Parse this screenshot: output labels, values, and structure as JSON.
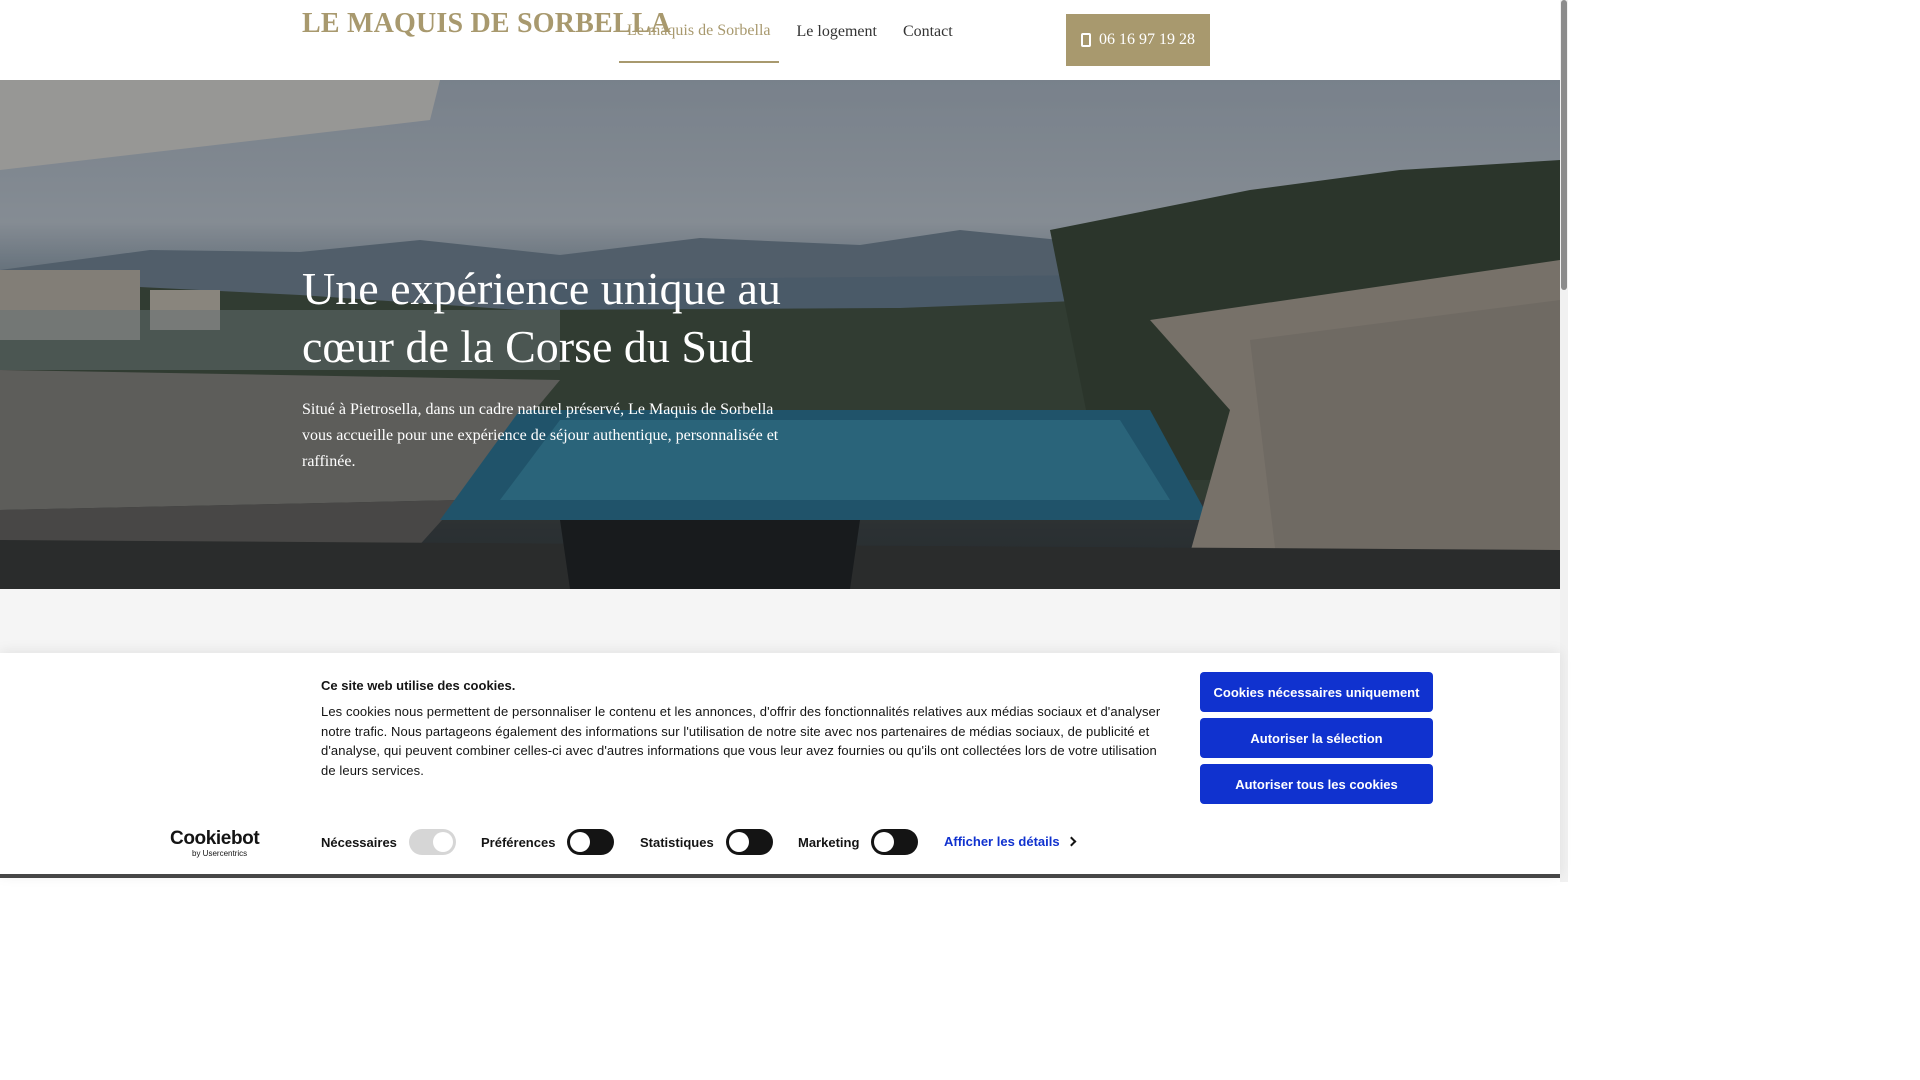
{
  "header": {
    "logo": "LE MAQUIS DE SORBELLA",
    "nav": [
      {
        "label": "Le maquis de Sorbella",
        "active": true
      },
      {
        "label": "Le logement",
        "active": false
      },
      {
        "label": "Contact",
        "active": false
      }
    ],
    "phone": "06 16 97 19 28"
  },
  "hero": {
    "title": "Une expérience unique au cœur de la Corse du Sud",
    "text": "Situé à Pietrosella, dans un cadre naturel préservé, Le Maquis de Sorbella vous accueille pour une expérience de séjour authentique, personnalisée et raffinée."
  },
  "cookie_banner": {
    "title": "Ce site web utilise des cookies.",
    "body": "Les cookies nous permettent de personnaliser le contenu et les annonces, d'offrir des fonctionnalités relatives aux médias sociaux et d'analyser notre trafic. Nous partageons également des informations sur l'utilisation de notre site avec nos partenaires de médias sociaux, de publicité et d'analyse, qui peuvent combiner celles-ci avec d'autres informations que vous leur avez fournies ou qu'ils ont collectées lors de votre utilisation de leurs services.",
    "buttons": {
      "necessary_only": "Cookies nécessaires uniquement",
      "allow_selection": "Autoriser la sélection",
      "allow_all": "Autoriser tous les cookies"
    },
    "toggles": {
      "necessary": "Nécessaires",
      "preferences": "Préférences",
      "statistics": "Statistiques",
      "marketing": "Marketing"
    },
    "details_link": "Afficher les détails",
    "brand": {
      "main": "Cookiebot",
      "sub": "by Usercentrics"
    }
  },
  "colors": {
    "accent": "#a8996e",
    "cookie_button": "#1032cf",
    "toggle_off": "#141414"
  }
}
